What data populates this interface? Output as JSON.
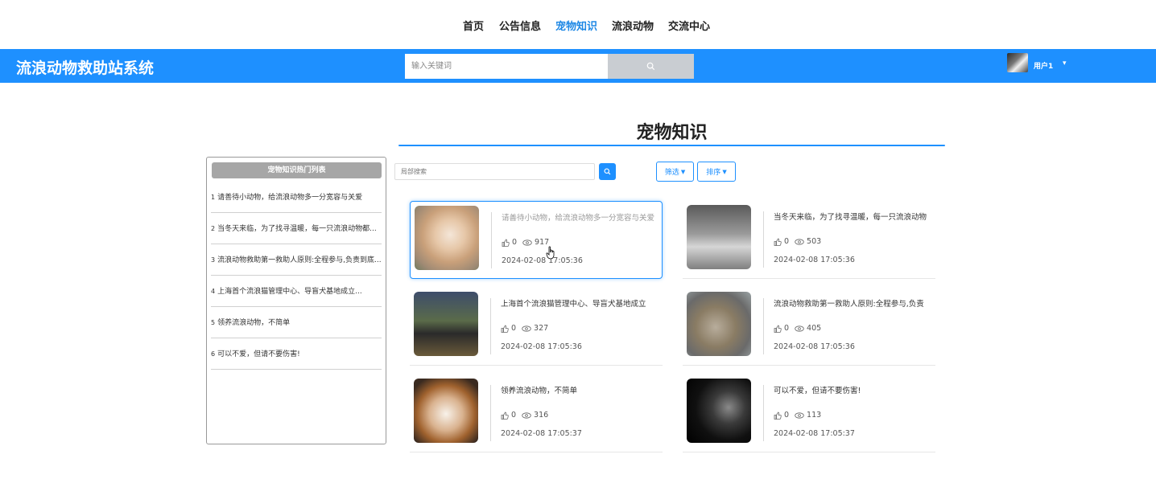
{
  "nav": {
    "items": [
      {
        "label": "首页"
      },
      {
        "label": "公告信息"
      },
      {
        "label": "宠物知识"
      },
      {
        "label": "流浪动物"
      },
      {
        "label": "交流中心"
      }
    ],
    "active_index": 2
  },
  "header": {
    "site_title": "流浪动物救助站系统",
    "search_placeholder": "输入关键词",
    "username": "用户1",
    "bar_color": "#1e90ff"
  },
  "page": {
    "title": "宠物知识"
  },
  "hotlist": {
    "title": "宠物知识热门列表",
    "items": [
      {
        "index": "1",
        "text": "请善待小动物，给流浪动物多一分宽容与关爱"
      },
      {
        "index": "2",
        "text": "当冬天来临，为了找寻温暖，每一只流浪动物都..."
      },
      {
        "index": "3",
        "text": "流浪动物救助第一救助人原则:全程参与,负责到底..."
      },
      {
        "index": "4",
        "text": "上海首个流浪猫管理中心、导盲犬基地成立..."
      },
      {
        "index": "5",
        "text": "领养流浪动物，不简单"
      },
      {
        "index": "6",
        "text": "可以不爱，但请不要伤害!"
      }
    ]
  },
  "toolbar": {
    "search_placeholder": "局部搜索",
    "filter_label": "筛选",
    "sort_label": "排序"
  },
  "cards": [
    {
      "title": "请善待小动物，给流浪动物多一分宽容与关爱",
      "likes": "0",
      "views": "917",
      "date": "2024-02-08 17:05:36",
      "image": "pomeranian-photo"
    },
    {
      "title": "当冬天来临，为了找寻温暖，每一只流浪动物",
      "likes": "0",
      "views": "503",
      "date": "2024-02-08 17:05:36",
      "image": "street-cat-photo"
    },
    {
      "title": "上海首个流浪猫管理中心、导盲犬基地成立",
      "likes": "0",
      "views": "327",
      "date": "2024-02-08 17:05:36",
      "image": "rottweiler-photo"
    },
    {
      "title": "流浪动物救助第一救助人原则:全程参与,负责",
      "likes": "0",
      "views": "405",
      "date": "2024-02-08 17:05:36",
      "image": "two-cats-photo"
    },
    {
      "title": "领养流浪动物，不简单",
      "likes": "0",
      "views": "316",
      "date": "2024-02-08 17:05:37",
      "image": "chihuahua-photo"
    },
    {
      "title": "可以不爱，但请不要伤害!",
      "likes": "0",
      "views": "113",
      "date": "2024-02-08 17:05:37",
      "image": "dark-cat-photo"
    }
  ],
  "colors": {
    "accent": "#1e90ff",
    "search_button": "#c9cdd2",
    "hot_header": "#a6a6a6"
  }
}
